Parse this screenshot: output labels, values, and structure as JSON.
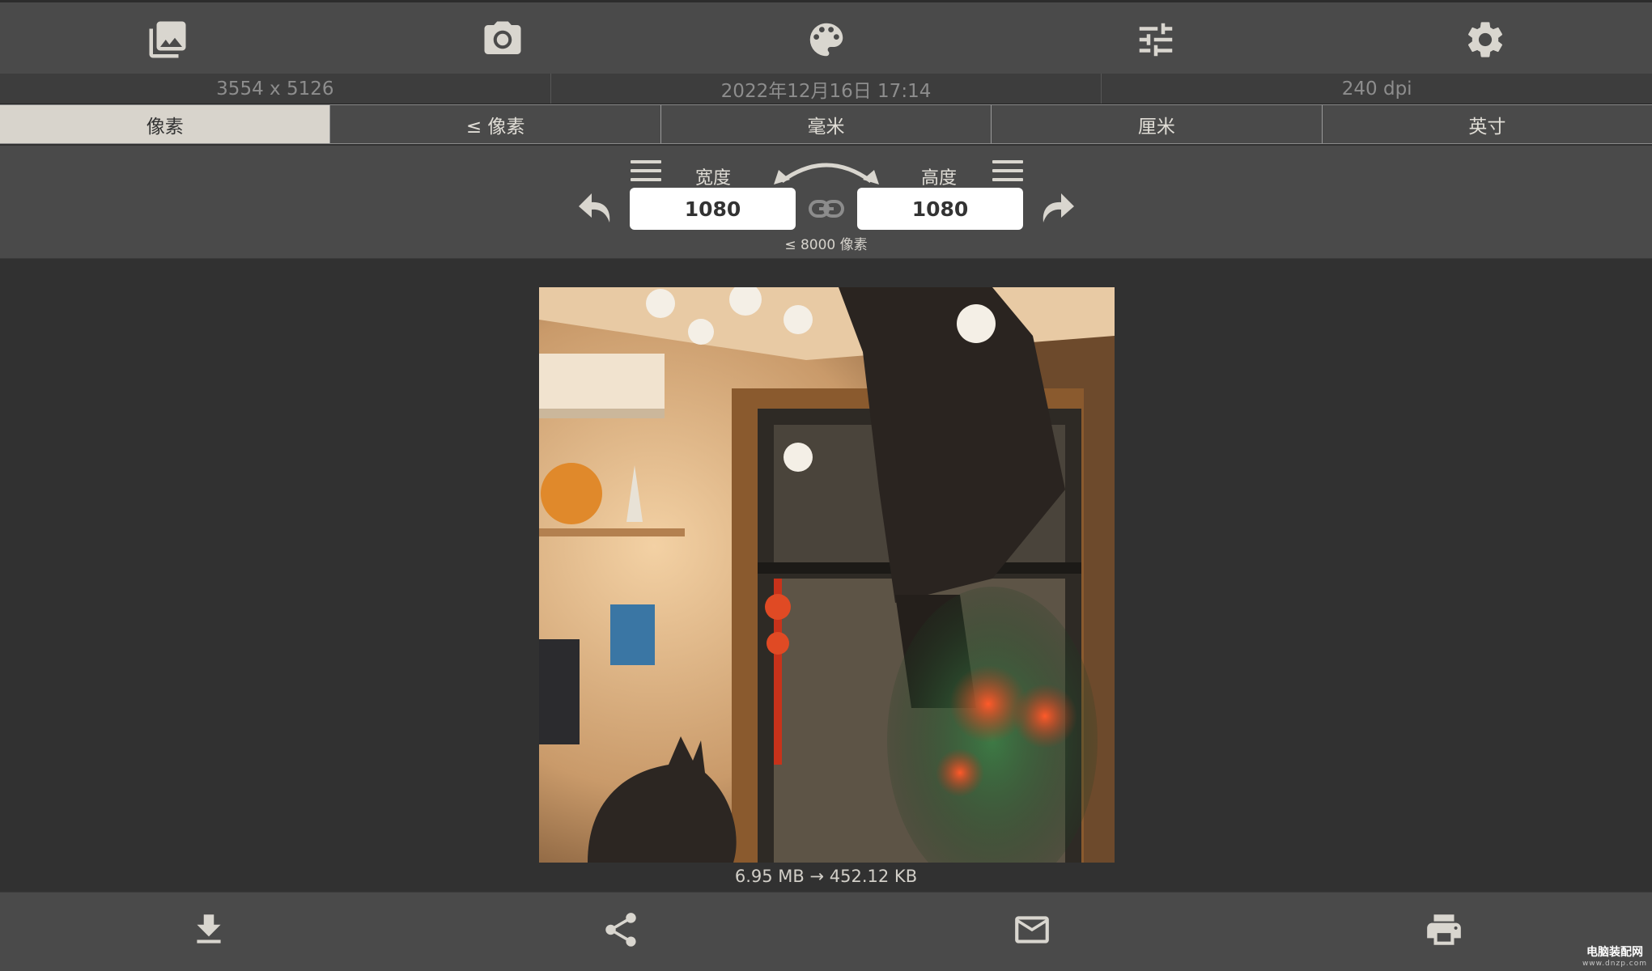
{
  "toolbar": {
    "items": [
      {
        "name": "photo-library",
        "icon": "gallery-icon"
      },
      {
        "name": "camera",
        "icon": "camera-icon"
      },
      {
        "name": "palette",
        "icon": "palette-icon"
      },
      {
        "name": "adjustments",
        "icon": "sliders-icon"
      },
      {
        "name": "settings",
        "icon": "gear-icon"
      }
    ]
  },
  "info": {
    "dimensions": "3554 x 5126",
    "date": "2022年12月16日 17:14",
    "dpi": "240 dpi"
  },
  "units": {
    "tabs": [
      "像素",
      "≤ 像素",
      "毫米",
      "厘米",
      "英寸"
    ],
    "selected": "像素"
  },
  "resize": {
    "width_label": "宽度",
    "height_label": "高度",
    "width_value": "1080",
    "height_value": "1080",
    "limit": "≤ 8000 像素",
    "aspect_locked": true
  },
  "file_size": "6.95 MB  →  452.12 KB",
  "bottom_bar": {
    "items": [
      {
        "name": "save",
        "icon": "download-icon"
      },
      {
        "name": "share",
        "icon": "share-icon"
      },
      {
        "name": "mail",
        "icon": "mail-icon"
      },
      {
        "name": "print",
        "icon": "printer-icon"
      }
    ]
  },
  "watermark": {
    "title": "电脑装配网",
    "url": "www.dnzp.com"
  },
  "colors": {
    "background": "#313131",
    "bar": "#4a4a4a",
    "icon": "#d9d6cf",
    "active_tab": "#d8d4cc"
  }
}
